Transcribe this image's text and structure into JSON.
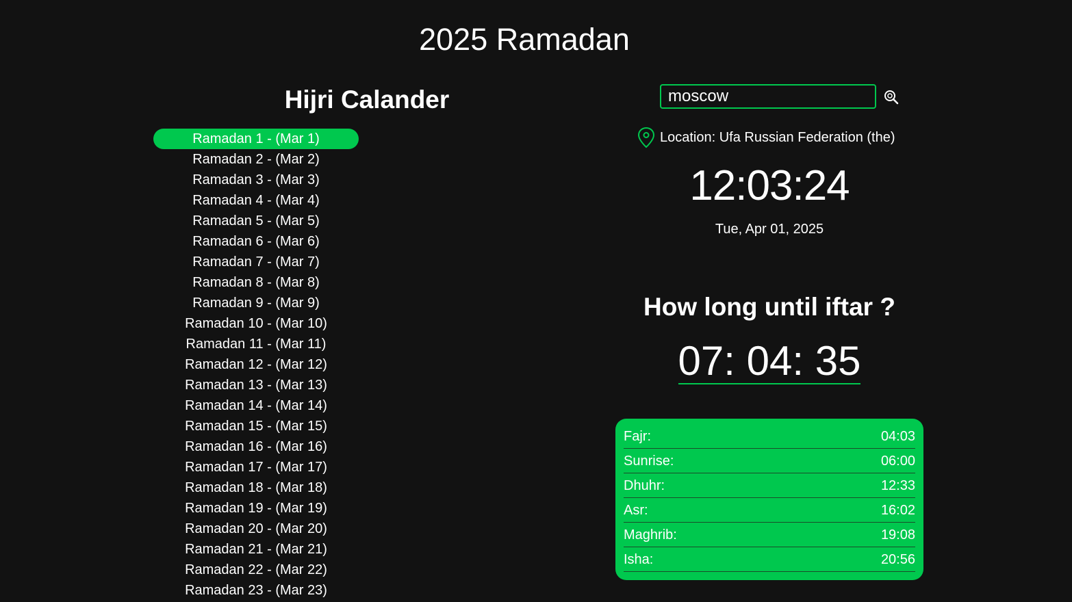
{
  "page_title": "2025 Ramadan",
  "calendar": {
    "title": "Hijri Calander",
    "days": [
      "Ramadan 1 - (Mar 1)",
      "Ramadan 2 - (Mar 2)",
      "Ramadan 3 - (Mar 3)",
      "Ramadan 4 - (Mar 4)",
      "Ramadan 5 - (Mar 5)",
      "Ramadan 6 - (Mar 6)",
      "Ramadan 7 - (Mar 7)",
      "Ramadan 8 - (Mar 8)",
      "Ramadan 9 - (Mar 9)",
      "Ramadan 10 - (Mar 10)",
      "Ramadan 11 - (Mar 11)",
      "Ramadan 12 - (Mar 12)",
      "Ramadan 13 - (Mar 13)",
      "Ramadan 14 - (Mar 14)",
      "Ramadan 15 - (Mar 15)",
      "Ramadan 16 - (Mar 16)",
      "Ramadan 17 - (Mar 17)",
      "Ramadan 18 - (Mar 18)",
      "Ramadan 19 - (Mar 19)",
      "Ramadan 20 - (Mar 20)",
      "Ramadan 21 - (Mar 21)",
      "Ramadan 22 - (Mar 22)",
      "Ramadan 23 - (Mar 23)"
    ],
    "active_index": 0
  },
  "search": {
    "value": "moscow",
    "icon": "search-icon"
  },
  "location": {
    "icon": "map-pin-icon",
    "label": "Location: Ufa Russian Federation (the)"
  },
  "clock": {
    "time": "12:03:24",
    "date": "Tue, Apr 01, 2025"
  },
  "iftar": {
    "heading": "How long until iftar ?",
    "countdown": "07: 04: 35"
  },
  "prayers": [
    {
      "name": "Fajr:",
      "time": "04:03"
    },
    {
      "name": "Sunrise:",
      "time": "06:00"
    },
    {
      "name": "Dhuhr:",
      "time": "12:33"
    },
    {
      "name": "Asr:",
      "time": "16:02"
    },
    {
      "name": "Maghrib:",
      "time": "19:08"
    },
    {
      "name": "Isha:",
      "time": "20:56"
    }
  ],
  "colors": {
    "accent": "#00c84e",
    "background": "#121212",
    "text": "#ffffff"
  }
}
